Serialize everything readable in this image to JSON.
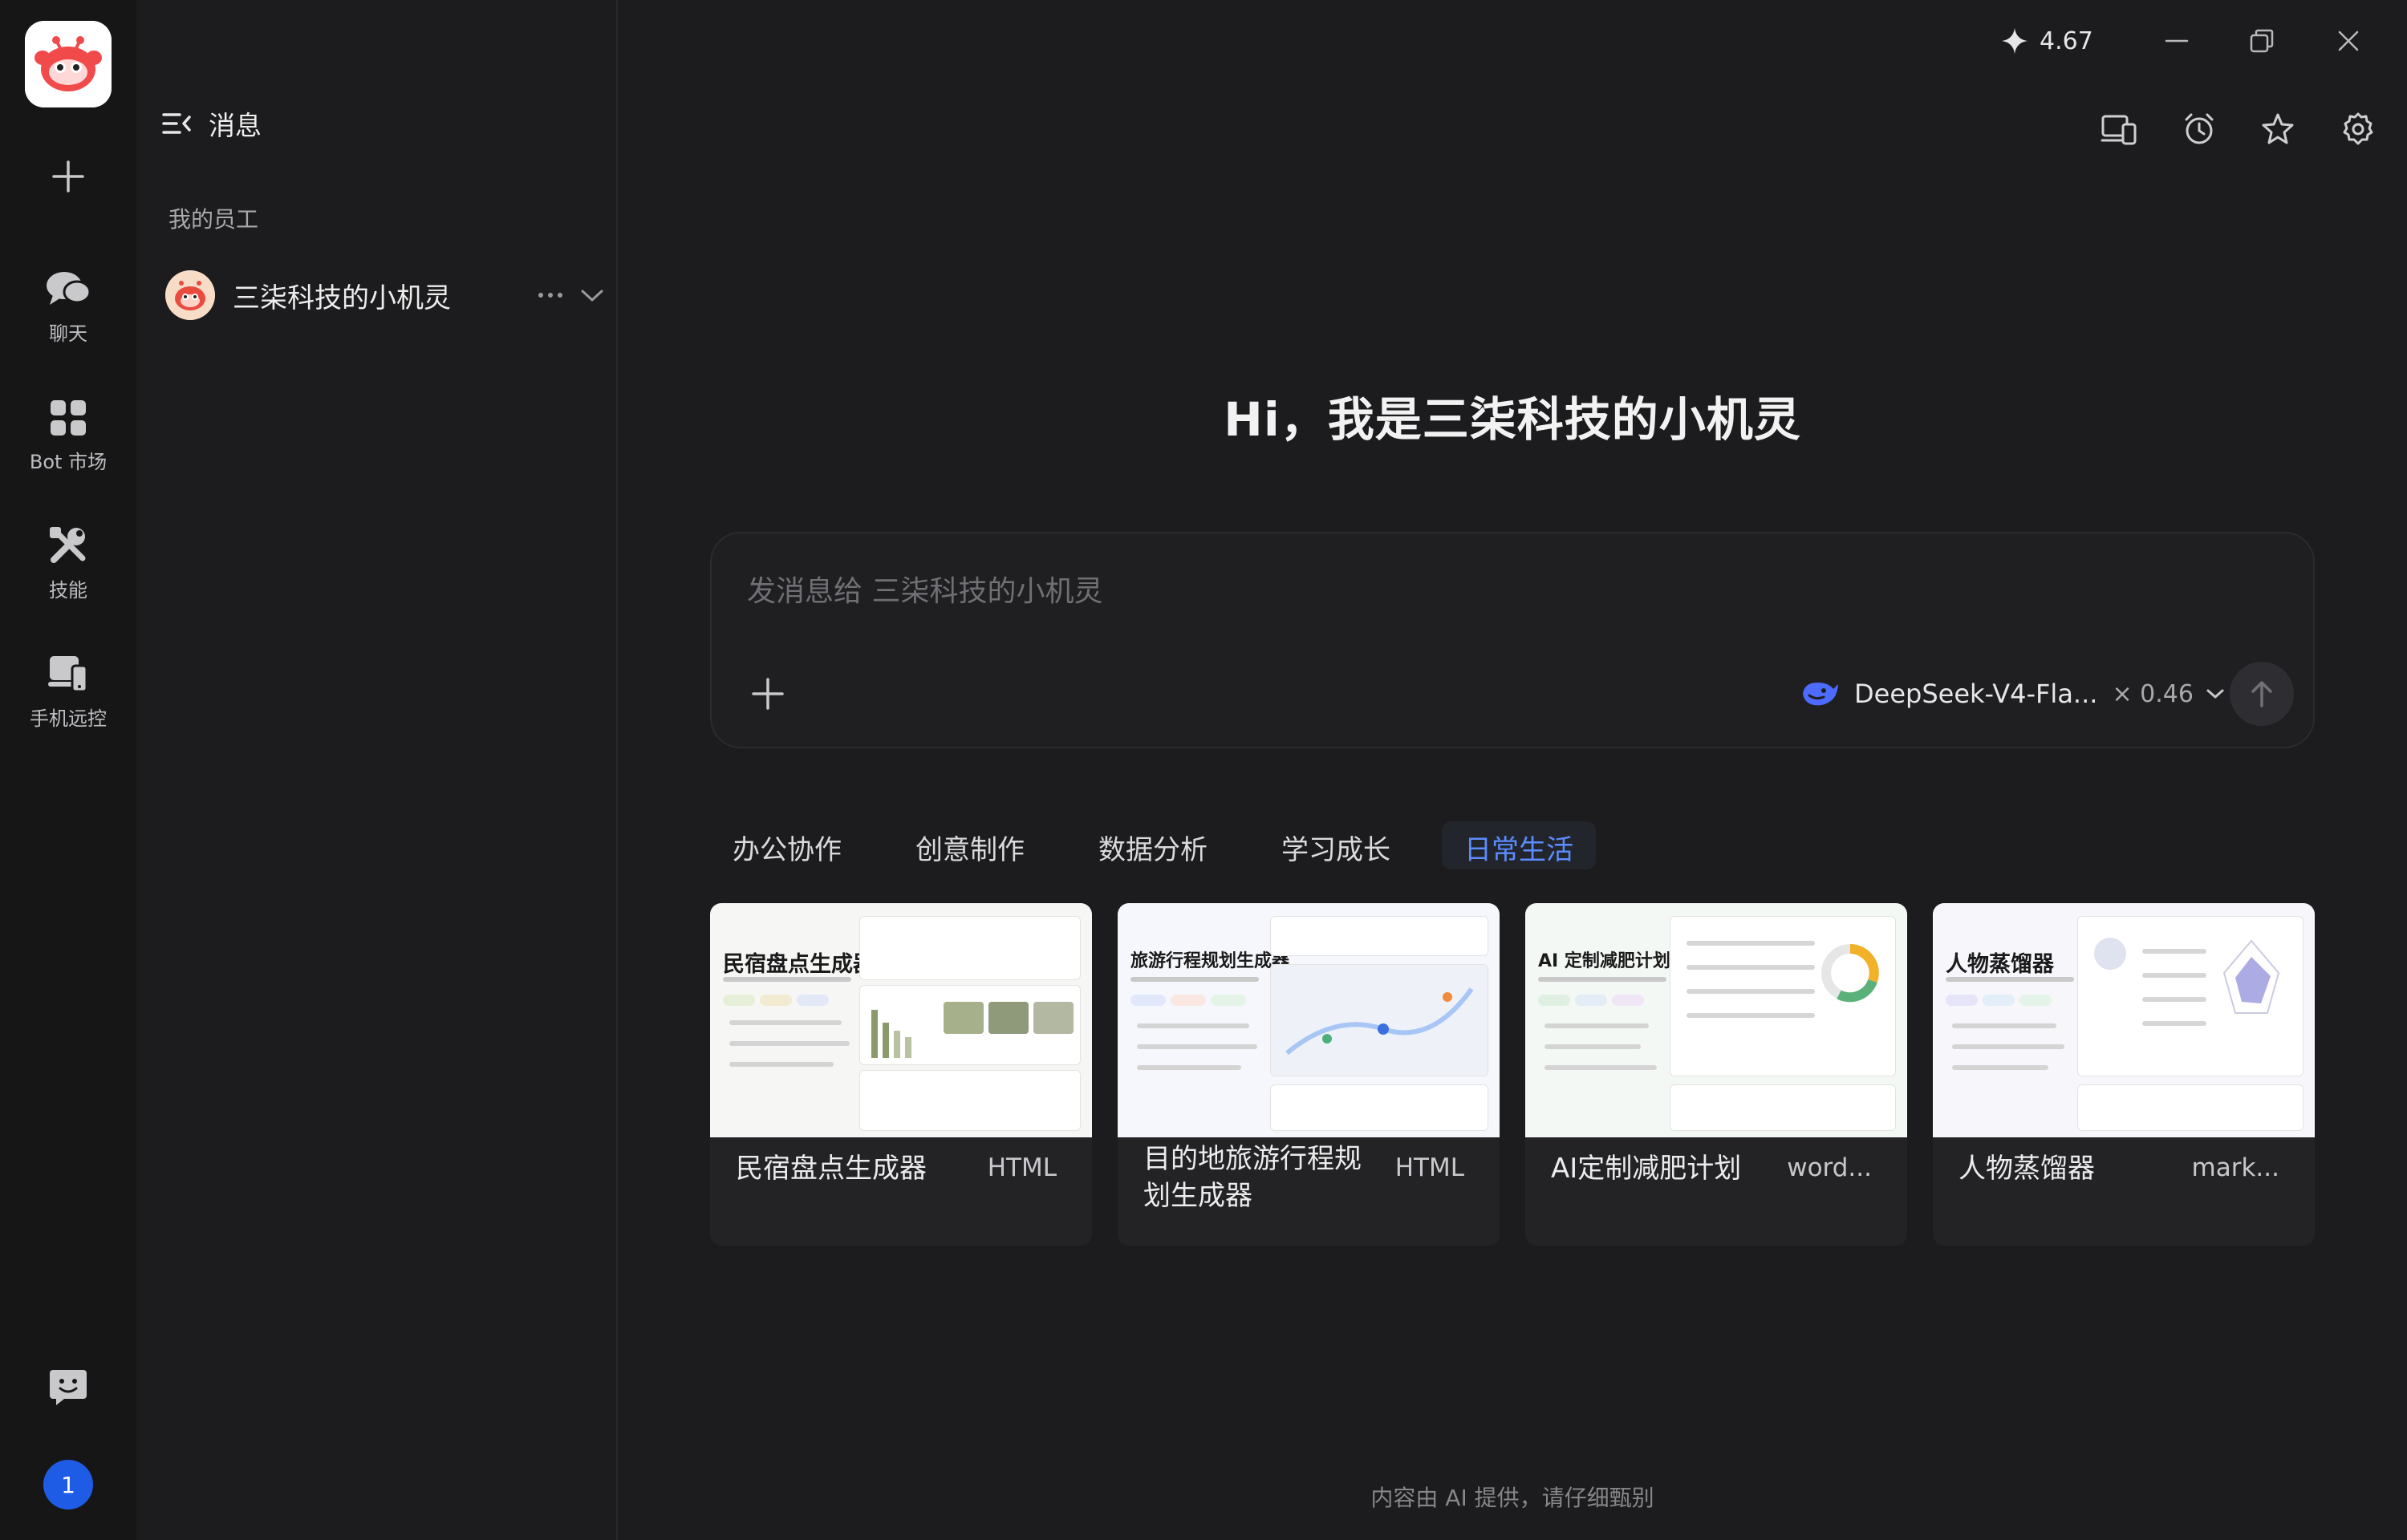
{
  "rail": {
    "items": [
      {
        "label": "聊天",
        "icon": "chat-icon"
      },
      {
        "label": "Bot 市场",
        "icon": "grid-icon"
      },
      {
        "label": "技能",
        "icon": "tools-icon"
      },
      {
        "label": "手机远控",
        "icon": "phone-remote-icon"
      }
    ],
    "notification_count": "1"
  },
  "panel": {
    "title": "消息",
    "section_label": "我的员工",
    "employee_name": "三柒科技的小机灵"
  },
  "topbar": {
    "credits": "4.67"
  },
  "main": {
    "greeting": "Hi，我是三柒科技的小机灵",
    "composer_placeholder": "发消息给 三柒科技的小机灵",
    "model_name": "DeepSeek-V4-Fla...",
    "model_multiplier": "× 0.46",
    "tabs": [
      {
        "label": "办公协作",
        "active": false
      },
      {
        "label": "创意制作",
        "active": false
      },
      {
        "label": "数据分析",
        "active": false
      },
      {
        "label": "学习成长",
        "active": false
      },
      {
        "label": "日常生活",
        "active": true
      }
    ],
    "cards": [
      {
        "title": "民宿盘点生成器",
        "format": "HTML",
        "thumb_title": "民宿盘点生成器"
      },
      {
        "title": "目的地旅游行程规划生成器",
        "format": "HTML",
        "thumb_title": "旅游行程规划生成器"
      },
      {
        "title": "AI定制减肥计划",
        "format": "word...",
        "thumb_title": "AI 定制减肥计划"
      },
      {
        "title": "人物蒸馏器",
        "format": "mark...",
        "thumb_title": "人物蒸馏器"
      }
    ],
    "disclaimer": "内容由 AI 提供，请仔细甄别"
  },
  "colors": {
    "accent": "#5b8dff",
    "badge": "#1f5ce6",
    "background": "#1c1c1e"
  }
}
